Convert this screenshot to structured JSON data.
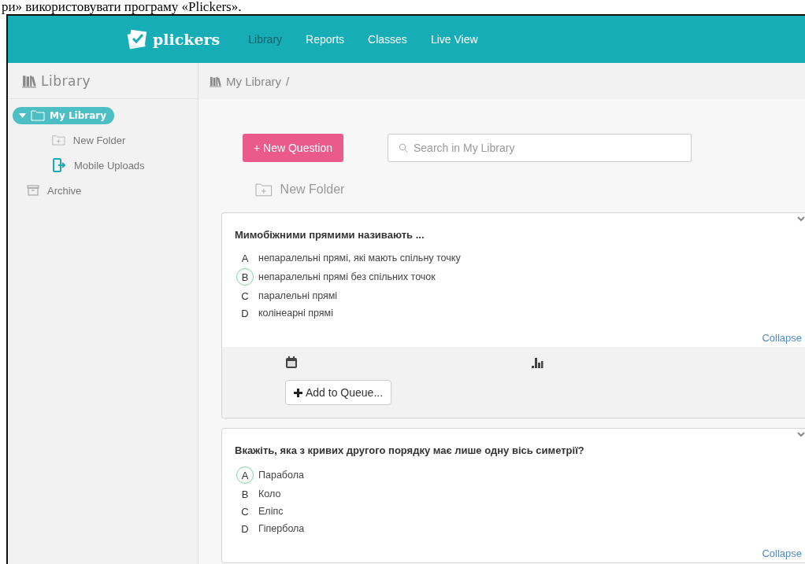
{
  "document_caption": "ри» використовувати програму «Plickers».",
  "nav": {
    "brand": "plickers",
    "tabs": [
      {
        "label": "Library",
        "selected": true
      },
      {
        "label": "Reports",
        "selected": false
      },
      {
        "label": "Classes",
        "selected": false
      },
      {
        "label": "Live View",
        "selected": false
      }
    ]
  },
  "sidebar": {
    "title": "Library",
    "items": [
      {
        "kind": "root",
        "label": "My Library",
        "expanded": true,
        "selected": true,
        "children": [
          {
            "kind": "new-folder",
            "label": "New Folder"
          },
          {
            "kind": "uploads",
            "label": "Mobile Uploads"
          }
        ]
      },
      {
        "kind": "archive",
        "label": "Archive"
      }
    ]
  },
  "breadcrumb": {
    "path": "My Library",
    "separator": "/"
  },
  "toolbar": {
    "new_question": "+ New Question",
    "search": {
      "placeholder": "Search in My Library"
    },
    "new_folder": "New Folder"
  },
  "questions": [
    {
      "title": "Мимобіжними прямими називають ...",
      "expanded": true,
      "collapse": "Collapse",
      "add_to_queue": "Add to Queue...",
      "answers": [
        {
          "letter": "A",
          "text": "непаралельні прямі, які мають спільну точку",
          "correct": false
        },
        {
          "letter": "B",
          "text": "непаралельні прямі без спільних точок",
          "correct": true
        },
        {
          "letter": "C",
          "text": "паралельні прямі",
          "correct": false
        },
        {
          "letter": "D",
          "text": "колінеарні прямі",
          "correct": false
        }
      ]
    },
    {
      "title": "Вкажіть, яка з кривих другого порядку має лише одну вісь симетрії?",
      "expanded": false,
      "collapse": "Collapse",
      "answers": [
        {
          "letter": "A",
          "text": "Парабола",
          "correct": true
        },
        {
          "letter": "B",
          "text": "Коло",
          "correct": false
        },
        {
          "letter": "C",
          "text": "Еліпс",
          "correct": false
        },
        {
          "letter": "D",
          "text": "Гіпербола",
          "correct": false
        }
      ]
    }
  ]
}
